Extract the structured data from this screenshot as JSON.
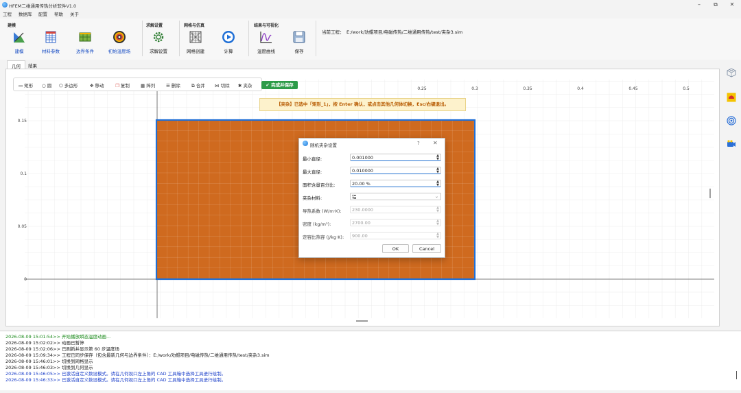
{
  "titlebar": {
    "title": "HFEM二维通用传热分析软件V1.0"
  },
  "menu": [
    "工程",
    "数据库",
    "配置",
    "帮助",
    "关于"
  ],
  "ribbon": {
    "groups": [
      {
        "title": "建模",
        "buttons": [
          "建模",
          "材料参数",
          "边界条件",
          "初始温度场"
        ]
      },
      {
        "title": "求解设置",
        "buttons": [
          "求解设置"
        ]
      },
      {
        "title": "网格与仿真",
        "buttons": [
          "网格创建",
          "计算"
        ]
      },
      {
        "title": "结果与可视化",
        "buttons": [
          "温度曲线",
          "保存"
        ]
      }
    ],
    "project_label": "当前工程：",
    "project_path": "E:/work/劝鲲项目/电磁传热/二维通用传热/test/夹杂3.sim"
  },
  "view_tabs": [
    "几何",
    "结果"
  ],
  "cad_toolbar": {
    "tools": [
      "矩形",
      "圆",
      "多边形",
      "移动",
      "复制",
      "阵列",
      "删除",
      "合并",
      "切除",
      "夹杂"
    ],
    "finish_label": "完成并保存"
  },
  "plot": {
    "x_ticks": [
      "0.25",
      "0.3",
      "0.35",
      "0.4",
      "0.45",
      "0.5"
    ],
    "y_ticks": [
      "0.15",
      "0.1",
      "0.05",
      "0"
    ],
    "rect_color": "#cf6a1f",
    "rect_border": "#1f6fd6"
  },
  "hint": "【夹杂】已选中「矩形_1」，按 Enter 确认，或点击其他几何体切换，Esc/右键退出。",
  "dialog": {
    "title": "随机夹杂设置",
    "help": "?",
    "fields": [
      {
        "label": "最小直径:",
        "value": "0.001000",
        "type": "spin",
        "disabled": false
      },
      {
        "label": "最大直径:",
        "value": "0.010000",
        "type": "spin",
        "disabled": false
      },
      {
        "label": "面积含量百分比:",
        "value": "20.00 %",
        "type": "spin",
        "disabled": false
      },
      {
        "label": "夹杂材料:",
        "value": "铝",
        "type": "select",
        "disabled": false
      },
      {
        "label": "导热系数 (W/m·K):",
        "value": "230.0000",
        "type": "spin",
        "disabled": true
      },
      {
        "label": "密度 (kg/m³):",
        "value": "2700.00",
        "type": "spin",
        "disabled": true
      },
      {
        "label": "定容比热容 (J/kg·K):",
        "value": "900.00",
        "type": "spin",
        "disabled": true
      }
    ],
    "ok": "OK",
    "cancel": "Cancel"
  },
  "log": [
    {
      "text": "2026-08-09 15:01:54>> 开始播放瞬态温度动画...",
      "color": "#1a8a1a"
    },
    {
      "text": "2026-08-09 15:02:02>> 动画已暂停",
      "color": "#222222"
    },
    {
      "text": "2026-08-09 15:02:06>> 已刷新并显示第 60 步温度场",
      "color": "#222222"
    },
    {
      "text": "2026-08-09 15:09:34>> 工程已同步保存（包含最新几何与边界条件）：E:/work/劝鲲项目/电磁传热/二维通用传热/test/夹杂3.sim",
      "color": "#222222"
    },
    {
      "text": "2026-08-09 15:46:01>> 切换到网格显示",
      "color": "#222222"
    },
    {
      "text": "2026-08-09 15:46:03>> 切换到几何显示",
      "color": "#222222"
    },
    {
      "text": "2026-08-09 15:46:05>> 已激活自定义数设模式。请在几何视口左上角的 CAD 工具箱中选择工具进行绘制。",
      "color": "#1b3fc9"
    },
    {
      "text": "2026-08-09 15:46:33>> 已激活自定义数设模式。请在几何视口左上角的 CAD 工具箱中选择工具进行绘制。",
      "color": "#1b3fc9"
    }
  ],
  "side_icons": [
    "mesh-cube-icon",
    "red-blob-icon",
    "target-icon",
    "camera-icon"
  ]
}
